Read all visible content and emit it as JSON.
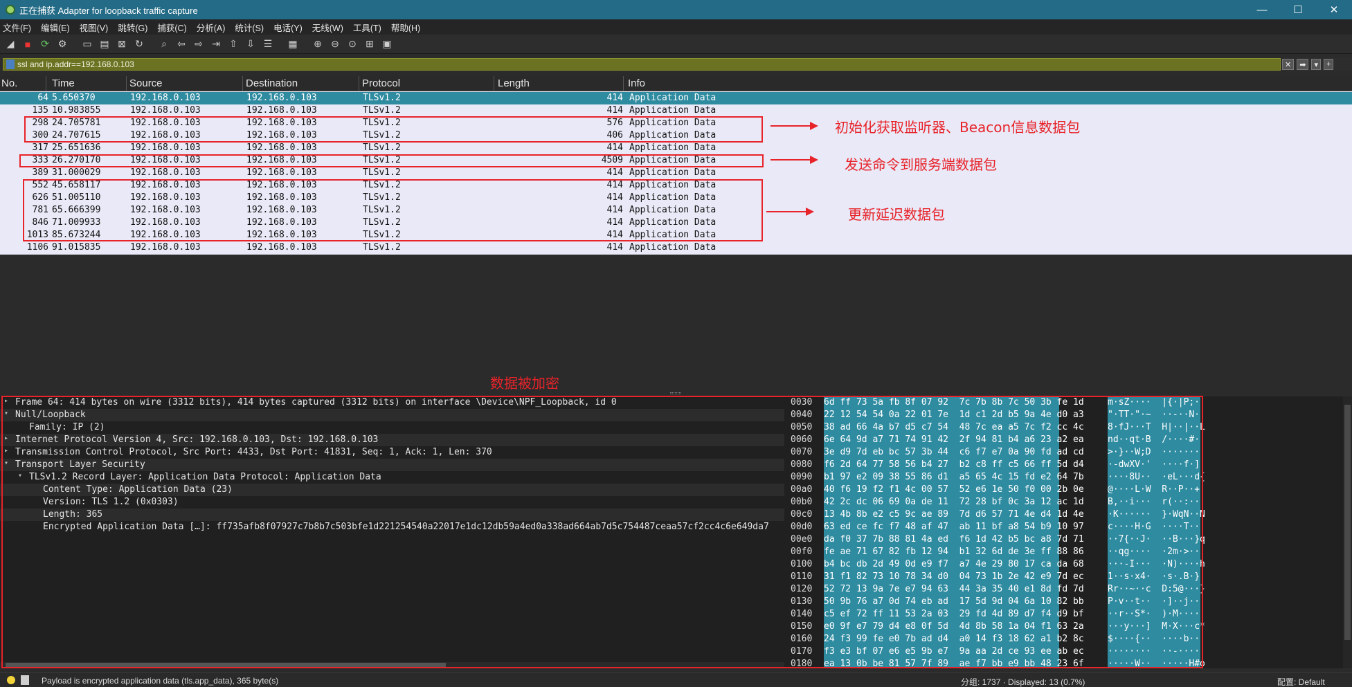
{
  "window": {
    "title": "正在捕获 Adapter for loopback traffic capture",
    "controls": [
      "minimize-icon",
      "maximize-icon",
      "close-icon"
    ]
  },
  "menu": [
    "文件(F)",
    "编辑(E)",
    "视图(V)",
    "跳转(G)",
    "捕获(C)",
    "分析(A)",
    "统计(S)",
    "电话(Y)",
    "无线(W)",
    "工具(T)",
    "帮助(H)"
  ],
  "filter": {
    "value": "ssl and ip.addr==192.168.0.103",
    "buttons": [
      "✕",
      "➡",
      "▾",
      "+"
    ]
  },
  "columns": {
    "no": "No.",
    "time": "Time",
    "source": "Source",
    "destination": "Destination",
    "protocol": "Protocol",
    "length": "Length",
    "info": "Info"
  },
  "packets": [
    {
      "no": "64",
      "time": "5.650370",
      "src": "192.168.0.103",
      "dst": "192.168.0.103",
      "proto": "TLSv1.2",
      "len": "414",
      "info": "Application Data"
    },
    {
      "no": "135",
      "time": "10.983855",
      "src": "192.168.0.103",
      "dst": "192.168.0.103",
      "proto": "TLSv1.2",
      "len": "414",
      "info": "Application Data"
    },
    {
      "no": "298",
      "time": "24.705781",
      "src": "192.168.0.103",
      "dst": "192.168.0.103",
      "proto": "TLSv1.2",
      "len": "576",
      "info": "Application Data"
    },
    {
      "no": "300",
      "time": "24.707615",
      "src": "192.168.0.103",
      "dst": "192.168.0.103",
      "proto": "TLSv1.2",
      "len": "406",
      "info": "Application Data"
    },
    {
      "no": "317",
      "time": "25.651636",
      "src": "192.168.0.103",
      "dst": "192.168.0.103",
      "proto": "TLSv1.2",
      "len": "414",
      "info": "Application Data"
    },
    {
      "no": "333",
      "time": "26.270170",
      "src": "192.168.0.103",
      "dst": "192.168.0.103",
      "proto": "TLSv1.2",
      "len": "4509",
      "info": "Application Data"
    },
    {
      "no": "389",
      "time": "31.000029",
      "src": "192.168.0.103",
      "dst": "192.168.0.103",
      "proto": "TLSv1.2",
      "len": "414",
      "info": "Application Data"
    },
    {
      "no": "552",
      "time": "45.658117",
      "src": "192.168.0.103",
      "dst": "192.168.0.103",
      "proto": "TLSv1.2",
      "len": "414",
      "info": "Application Data"
    },
    {
      "no": "626",
      "time": "51.005110",
      "src": "192.168.0.103",
      "dst": "192.168.0.103",
      "proto": "TLSv1.2",
      "len": "414",
      "info": "Application Data"
    },
    {
      "no": "781",
      "time": "65.666399",
      "src": "192.168.0.103",
      "dst": "192.168.0.103",
      "proto": "TLSv1.2",
      "len": "414",
      "info": "Application Data"
    },
    {
      "no": "846",
      "time": "71.009933",
      "src": "192.168.0.103",
      "dst": "192.168.0.103",
      "proto": "TLSv1.2",
      "len": "414",
      "info": "Application Data"
    },
    {
      "no": "1013",
      "time": "85.673244",
      "src": "192.168.0.103",
      "dst": "192.168.0.103",
      "proto": "TLSv1.2",
      "len": "414",
      "info": "Application Data"
    },
    {
      "no": "1106",
      "time": "91.015835",
      "src": "192.168.0.103",
      "dst": "192.168.0.103",
      "proto": "TLSv1.2",
      "len": "414",
      "info": "Application Data"
    }
  ],
  "annotations": {
    "group1": "初始化获取监听器、Beacon信息数据包",
    "group2": "发送命令到服务端数据包",
    "group3": "更新延迟数据包",
    "encrypted": "数据被加密"
  },
  "details": [
    {
      "indent": 0,
      "tri": "▸",
      "text": "Frame 64: 414 bytes on wire (3312 bits), 414 bytes captured (3312 bits) on interface \\Device\\NPF_Loopback, id 0"
    },
    {
      "indent": 0,
      "tri": "▾",
      "text": "Null/Loopback"
    },
    {
      "indent": 1,
      "tri": "",
      "text": "Family: IP (2)"
    },
    {
      "indent": 0,
      "tri": "▸",
      "text": "Internet Protocol Version 4, Src: 192.168.0.103, Dst: 192.168.0.103"
    },
    {
      "indent": 0,
      "tri": "▸",
      "text": "Transmission Control Protocol, Src Port: 4433, Dst Port: 41831, Seq: 1, Ack: 1, Len: 370"
    },
    {
      "indent": 0,
      "tri": "▾",
      "text": "Transport Layer Security"
    },
    {
      "indent": 1,
      "tri": "▾",
      "text": "TLSv1.2 Record Layer: Application Data Protocol: Application Data"
    },
    {
      "indent": 2,
      "tri": "",
      "text": "Content Type: Application Data (23)"
    },
    {
      "indent": 2,
      "tri": "",
      "text": "Version: TLS 1.2 (0x0303)"
    },
    {
      "indent": 2,
      "tri": "",
      "text": "Length: 365"
    },
    {
      "indent": 2,
      "tri": "",
      "text": "Encrypted Application Data […]: ff735afb8f07927c7b8b7c503bfe1d221254540a22017e1dc12db59a4ed0a338ad664ab7d5c754487ceaa57cf2cc4c6e649da7"
    }
  ],
  "hex": [
    {
      "off": "0030",
      "bytes": "6d ff 73 5a fb 8f 07 92  7c 7b 8b 7c 50 3b fe 1d",
      "ascii": "m·sZ····  |{·|P;··"
    },
    {
      "off": "0040",
      "bytes": "22 12 54 54 0a 22 01 7e  1d c1 2d b5 9a 4e d0 a3",
      "ascii": "\"·TT·\"·~  ··-··N··"
    },
    {
      "off": "0050",
      "bytes": "38 ad 66 4a b7 d5 c7 54  48 7c ea a5 7c f2 cc 4c",
      "ascii": "8·fJ···T  H|··|··L"
    },
    {
      "off": "0060",
      "bytes": "6e 64 9d a7 71 74 91 42  2f 94 81 b4 a6 23 a2 ea",
      "ascii": "nd··qt·B  /····#··"
    },
    {
      "off": "0070",
      "bytes": "3e d9 7d eb bc 57 3b 44  c6 f7 e7 0a 90 fd ad cd",
      "ascii": ">·}··W;D  ········"
    },
    {
      "off": "0080",
      "bytes": "f6 2d 64 77 58 56 b4 27  b2 c8 ff c5 66 ff 5d d4",
      "ascii": "·-dwXV·'  ····f·]·"
    },
    {
      "off": "0090",
      "bytes": "b1 97 e2 09 38 55 86 d1  a5 65 4c 15 fd e2 64 7b",
      "ascii": "····8U··  ·eL···d{"
    },
    {
      "off": "00a0",
      "bytes": "40 f6 19 f2 f1 4c 00 57  52 e6 1e 50 f0 00 2b 0e",
      "ascii": "@····L·W  R··P··+·"
    },
    {
      "off": "00b0",
      "bytes": "42 2c dc 06 69 0a de 11  72 28 bf 0c 3a 12 ac 1d",
      "ascii": "B,··i···  r(··:···"
    },
    {
      "off": "00c0",
      "bytes": "13 4b 8b e2 c5 9c ae 89  7d d6 57 71 4e d4 1d 4e",
      "ascii": "·K······  }·WqN··N"
    },
    {
      "off": "00d0",
      "bytes": "63 ed ce fc f7 48 af 47  ab 11 bf a8 54 b9 10 97",
      "ascii": "c····H·G  ····T···"
    },
    {
      "off": "00e0",
      "bytes": "da f0 37 7b 88 81 4a ed  f6 1d 42 b5 bc a8 7d 71",
      "ascii": "··7{··J·  ··B···}q"
    },
    {
      "off": "00f0",
      "bytes": "fe ae 71 67 82 fb 12 94  b1 32 6d de 3e ff 88 86",
      "ascii": "··qg····  ·2m·>···"
    },
    {
      "off": "0100",
      "bytes": "b4 bc db 2d 49 0d e9 f7  a7 4e 29 80 17 ca da 68",
      "ascii": "···-I···  ·N)····h"
    },
    {
      "off": "0110",
      "bytes": "31 f1 82 73 10 78 34 d0  04 73 1b 2e 42 e9 7d ec",
      "ascii": "1··s·x4·  ·s·.B·}·"
    },
    {
      "off": "0120",
      "bytes": "52 72 13 9a 7e e7 94 63  44 3a 35 40 e1 8d fd 7d",
      "ascii": "Rr··~··c  D:5@···}"
    },
    {
      "off": "0130",
      "bytes": "50 9b 76 a7 0d 74 eb ad  17 5d 9d 04 6a 10 82 bb",
      "ascii": "P·v··t··  ·]··j···"
    },
    {
      "off": "0140",
      "bytes": "c5 ef 72 ff 11 53 2a 03  29 fd 4d 89 d7 f4 d9 bf",
      "ascii": "··r··S*·  )·M·····"
    },
    {
      "off": "0150",
      "bytes": "e0 9f e7 79 d4 e8 0f 5d  4d 8b 58 1a 04 f1 63 2a",
      "ascii": "···y···]  M·X···c*"
    },
    {
      "off": "0160",
      "bytes": "24 f3 99 fe e0 7b ad d4  a0 14 f3 18 62 a1 b2 8c",
      "ascii": "$····{··  ····b···"
    },
    {
      "off": "0170",
      "bytes": "f3 e3 bf 07 e6 e5 9b e7  9a aa 2d ce 93 ee ab ec",
      "ascii": "········  ··-·····"
    },
    {
      "off": "0180",
      "bytes": "ea 13 0b be 81 57 7f 89  ae f7 bb e9 bb 48 23 6f",
      "ascii": "·····W··  ·····H#o"
    }
  ],
  "status": {
    "left": "Payload is encrypted application data (tls.app_data), 365 byte(s)",
    "packets": "分组: 1737 · Displayed: 13 (0.7%)",
    "profile": "配置: Default"
  },
  "colors": {
    "selected": "#2f8ba0",
    "annotation": "#e8232a",
    "filter": "#6b7322",
    "listbg": "#e9e9f7"
  }
}
